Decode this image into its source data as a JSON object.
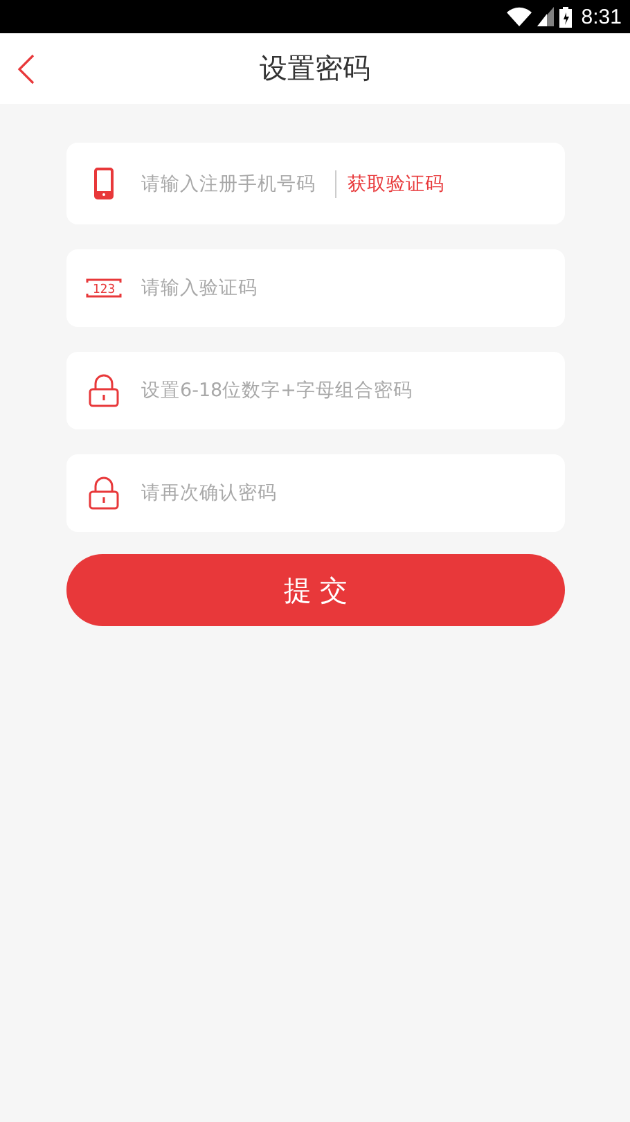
{
  "status_bar": {
    "time": "8:31"
  },
  "header": {
    "title": "设置密码"
  },
  "fields": [
    {
      "kind": "phone",
      "placeholder": "请输入注册手机号码",
      "action": "获取验证码"
    },
    {
      "kind": "code",
      "icon_text": "123",
      "placeholder": "请输入验证码"
    },
    {
      "kind": "lock",
      "placeholder": "设置6-18位数字+字母组合密码"
    },
    {
      "kind": "lock",
      "placeholder": "请再次确认密码"
    }
  ],
  "submit": {
    "label": "提 交"
  }
}
